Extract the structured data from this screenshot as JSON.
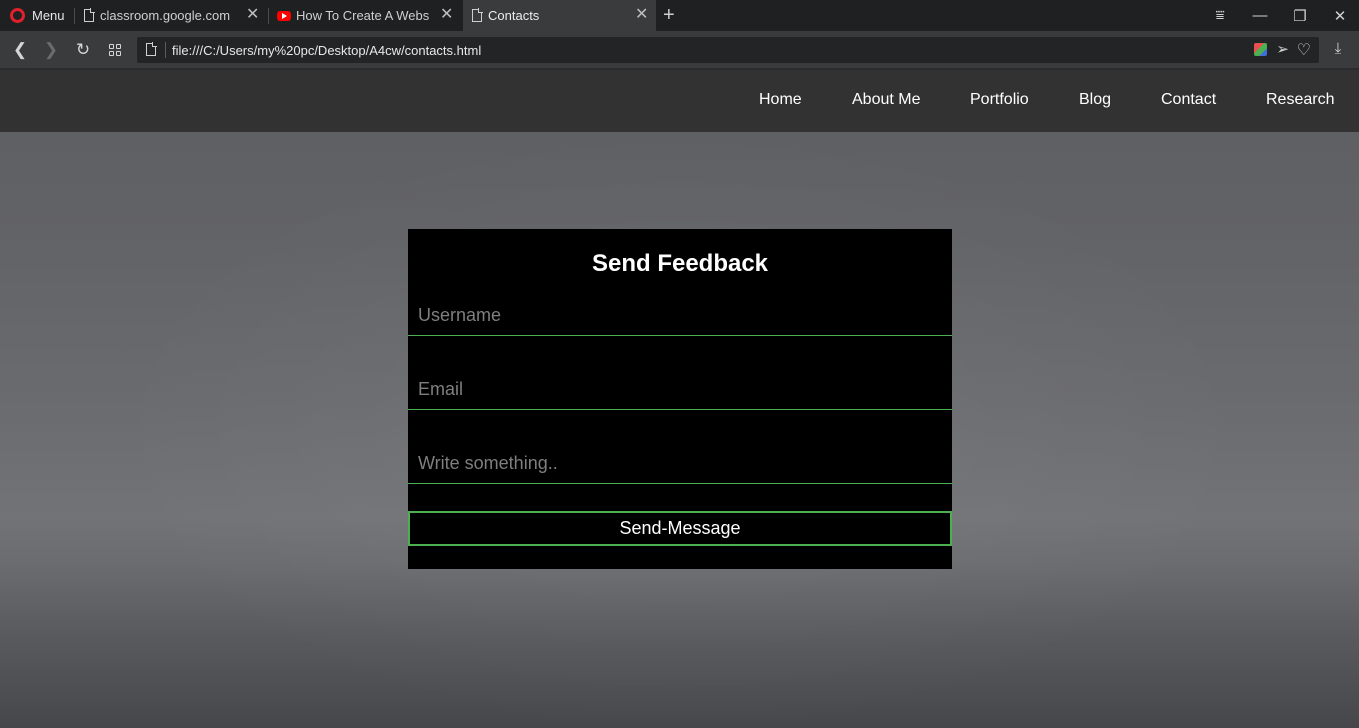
{
  "browser": {
    "menu_label": "Menu",
    "tabs": [
      {
        "title": "classroom.google.com",
        "icon": "page-icon"
      },
      {
        "title": "How To Create A Website",
        "icon": "youtube-icon"
      },
      {
        "title": "Contacts",
        "icon": "page-icon",
        "active": true
      }
    ],
    "new_tab_glyph": "+",
    "close_glyph": "✕",
    "url": "file:///C:/Users/my%20pc/Desktop/A4cw/contacts.html",
    "window_controls": {
      "stash": "⩸",
      "minimize": "—",
      "restore": "❐",
      "close": "✕"
    },
    "nav": {
      "back": "❮",
      "forward": "❯",
      "reload": "↻"
    },
    "send_glyph": "➢",
    "heart_glyph": "♡",
    "download_glyph": "⤓"
  },
  "site_nav": {
    "items": [
      "Home",
      "About Me",
      "Portfolio",
      "Blog",
      "Contact",
      "Research"
    ]
  },
  "form": {
    "title": "Send Feedback",
    "username_placeholder": "Username",
    "email_placeholder": "Email",
    "message_placeholder": "Write something..",
    "submit_label": "Send-Message"
  },
  "colors": {
    "accent_green": "#4caf50",
    "nav_bg": "#323232",
    "form_bg": "#000000",
    "opera_red": "#e0202c"
  }
}
